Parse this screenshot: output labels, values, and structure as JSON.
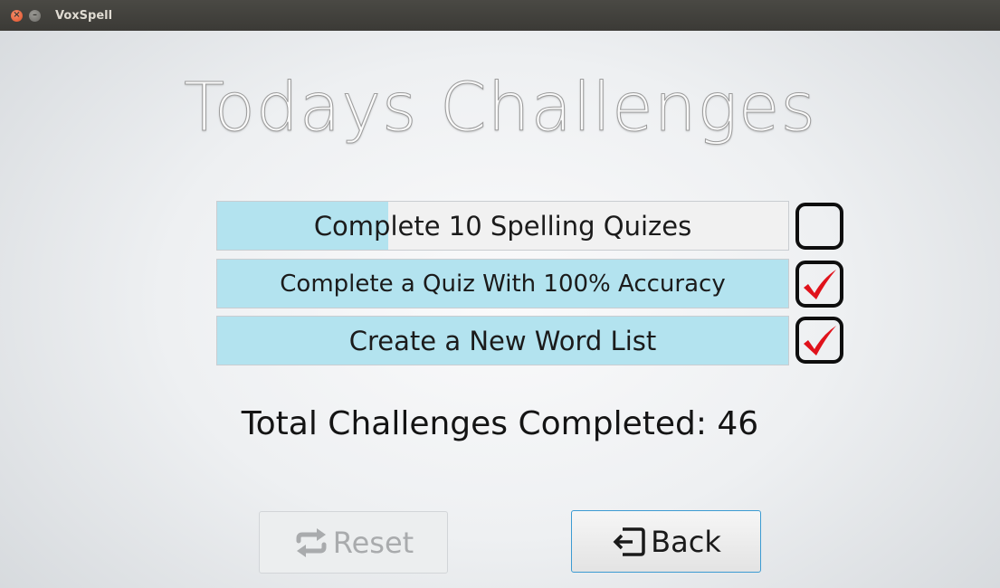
{
  "window": {
    "title": "VoxSpell",
    "close_glyph": "×",
    "minimize_glyph": "–"
  },
  "heading": "Todays Challenges",
  "challenges": [
    {
      "label": "Complete 10 Spelling Quizes",
      "progress": 0.3,
      "completed": false
    },
    {
      "label": "Complete a Quiz With 100% Accuracy",
      "progress": 1.0,
      "completed": true
    },
    {
      "label": "Create a New Word List",
      "progress": 1.0,
      "completed": true
    }
  ],
  "total": {
    "text": "Total Challenges Completed: 46"
  },
  "buttons": {
    "reset": {
      "label": "Reset",
      "icon": "repeat-icon",
      "enabled": false
    },
    "back": {
      "label": "Back",
      "icon": "sign-out-icon",
      "enabled": true
    }
  },
  "colors": {
    "progress_fill": "#b3e3ef",
    "check_mark": "#e0121b",
    "focus_border": "#3c9bd2"
  }
}
